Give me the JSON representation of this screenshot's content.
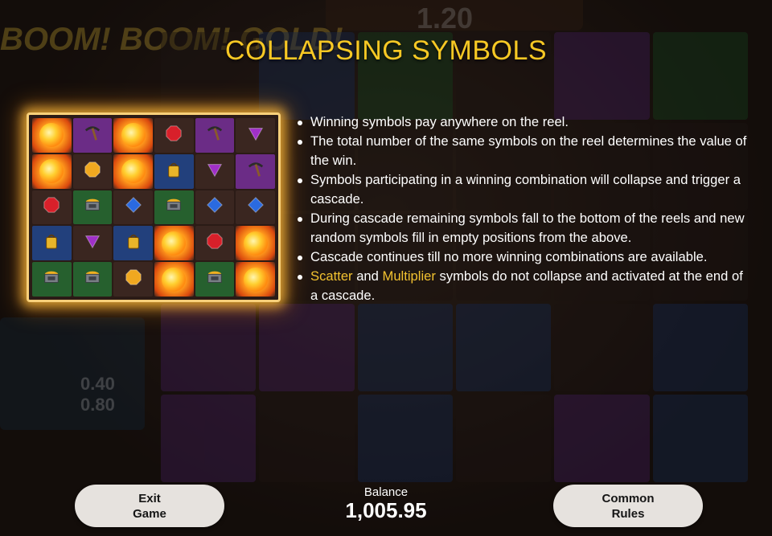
{
  "game": {
    "background_multiplier": "1.20",
    "background_logo": "BOOM! BOOM! GOLD!",
    "side_values": [
      "0.40",
      "0.80"
    ]
  },
  "title": "COLLAPSING SYMBOLS",
  "rules": [
    {
      "parts": [
        {
          "text": "Winning symbols pay anywhere on the reel.",
          "highlight": false
        }
      ]
    },
    {
      "parts": [
        {
          "text": "The total number of the same symbols on the reel determines the value of the win.",
          "highlight": false
        }
      ]
    },
    {
      "parts": [
        {
          "text": "Symbols participating in a winning combination will collapse and trigger a cascade.",
          "highlight": false
        }
      ]
    },
    {
      "parts": [
        {
          "text": "During cascade remaining symbols fall to the bottom of the reels and new random symbols fill in empty positions from the above.",
          "highlight": false
        }
      ]
    },
    {
      "parts": [
        {
          "text": "Cascade continues till no more winning combinations are available.",
          "highlight": false
        }
      ]
    },
    {
      "parts": [
        {
          "text": "Scatter",
          "highlight": true
        },
        {
          "text": " and ",
          "highlight": false
        },
        {
          "text": "Multiplier",
          "highlight": true
        },
        {
          "text": " symbols do not collapse and activated at the end of a cascade.",
          "highlight": false
        }
      ]
    }
  ],
  "illustration": {
    "rows": [
      [
        "fire",
        "pickaxe-purple",
        "fire",
        "ruby-dark",
        "pickaxe-purple",
        "amethyst-dark"
      ],
      [
        "fire",
        "topaz-dark",
        "fire",
        "lantern-blue",
        "amethyst-dark",
        "pickaxe-purple"
      ],
      [
        "ruby-dark",
        "cart-green",
        "sapphire-dark",
        "cart-green",
        "sapphire-dark",
        "sapphire-dark"
      ],
      [
        "lantern-blue",
        "amethyst-dark",
        "lantern-blue",
        "fire",
        "ruby-dark",
        "fire"
      ],
      [
        "cart-green",
        "cart-green",
        "topaz-dark",
        "fire",
        "cart-green",
        "fire"
      ]
    ]
  },
  "colors": {
    "title": "#f7c824",
    "highlight": "#f2c230",
    "panel_glow": "#ffbe3c"
  },
  "footer": {
    "exit_label_line1": "Exit",
    "exit_label_line2": "Game",
    "balance_label": "Balance",
    "balance_value": "1,005.95",
    "rules_label_line1": "Common",
    "rules_label_line2": "Rules"
  }
}
